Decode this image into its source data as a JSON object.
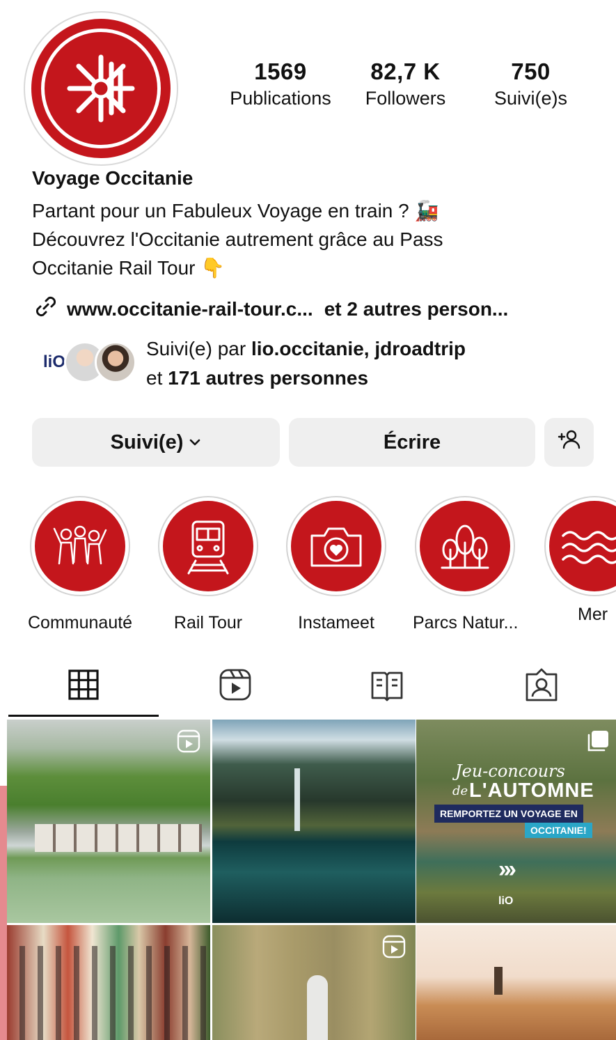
{
  "profile": {
    "name": "Voyage Occitanie",
    "bio_lines": [
      "Partant pour un Fabuleux Voyage en train ? 🚂",
      "Découvrez l'Occitanie autrement grâce au Pass",
      "Occitanie Rail Tour 👇"
    ],
    "link": "www.occitanie-rail-tour.c...",
    "link_suffix": "et 2 autres person...",
    "avatar_icon": "occitanie-cross-logo"
  },
  "stats": [
    {
      "value": "1569",
      "label": "Publications"
    },
    {
      "value": "82,7 K",
      "label": "Followers"
    },
    {
      "value": "750",
      "label": "Suivi(e)s"
    }
  ],
  "followed_by": {
    "prefix": "Suivi(e) par",
    "names": "lio.occitanie, jdroadtrip",
    "and": "et",
    "others": "171 autres personnes",
    "mini_logo": "liO"
  },
  "buttons": {
    "follow": "Suivi(e)",
    "message": "Écrire"
  },
  "highlights": [
    {
      "label": "Communauté",
      "icon": "community-icon"
    },
    {
      "label": "Rail Tour",
      "icon": "train-icon"
    },
    {
      "label": "Instameet",
      "icon": "camera-heart-icon"
    },
    {
      "label": "Parcs Natur...",
      "icon": "trees-icon"
    },
    {
      "label": "Mer",
      "icon": "waves-icon"
    }
  ],
  "tabs": [
    "grid-icon",
    "reels-icon",
    "guides-icon",
    "tagged-icon"
  ],
  "posts": [
    {
      "scene": "mountain village by a lake",
      "icon": "reel-icon"
    },
    {
      "scene": "mountain lake with waterfall",
      "icon": ""
    },
    {
      "scene": "contest promo",
      "icon": "carousel-icon",
      "overlay": {
        "line1": "Jeu-concours",
        "line2": "de",
        "line3": "L'AUTOMNE",
        "banner1": "REMPORTEZ UN VOYAGE EN",
        "banner2": "OCCITANIE!",
        "logo": "liO"
      }
    },
    {
      "scene": "colourful riverside houses",
      "icon": ""
    },
    {
      "scene": "canal boat aerial view",
      "icon": "reel-icon"
    },
    {
      "scene": "lighthouse on dunes",
      "icon": ""
    }
  ],
  "colors": {
    "brand_red": "#c4161c",
    "button_bg": "#efefef"
  }
}
